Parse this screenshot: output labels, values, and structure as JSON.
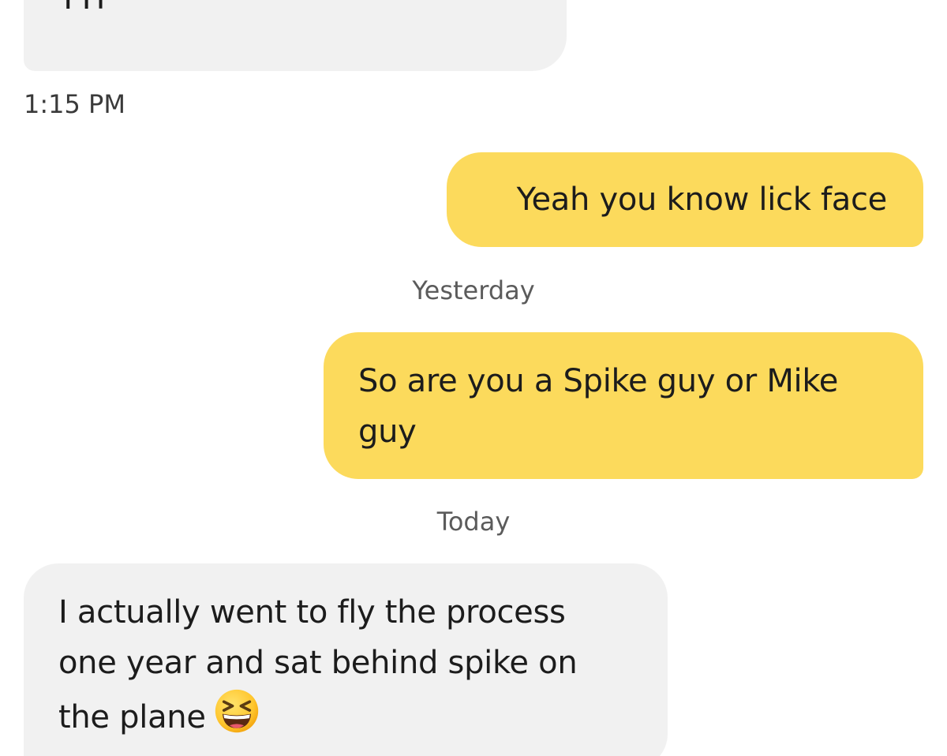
{
  "messages": [
    {
      "direction": "incoming",
      "text": "TTP"
    },
    {
      "direction": "outgoing",
      "text": "Yeah you know lick face"
    },
    {
      "direction": "outgoing",
      "text": "So are you a Spike guy or Mike guy"
    },
    {
      "direction": "incoming",
      "text": "I actually went to fly the process one year and sat behind spike on the plane",
      "emoji": "grinning-squinting-face"
    }
  ],
  "timestamps": {
    "first": "1:15 PM",
    "yesterday": "Yesterday",
    "today": "Today"
  },
  "colors": {
    "incoming_bubble": "#f1f1f1",
    "outgoing_bubble": "#fcda5c",
    "text": "#1c1c1c",
    "timestamp": "#5b5b5b"
  }
}
